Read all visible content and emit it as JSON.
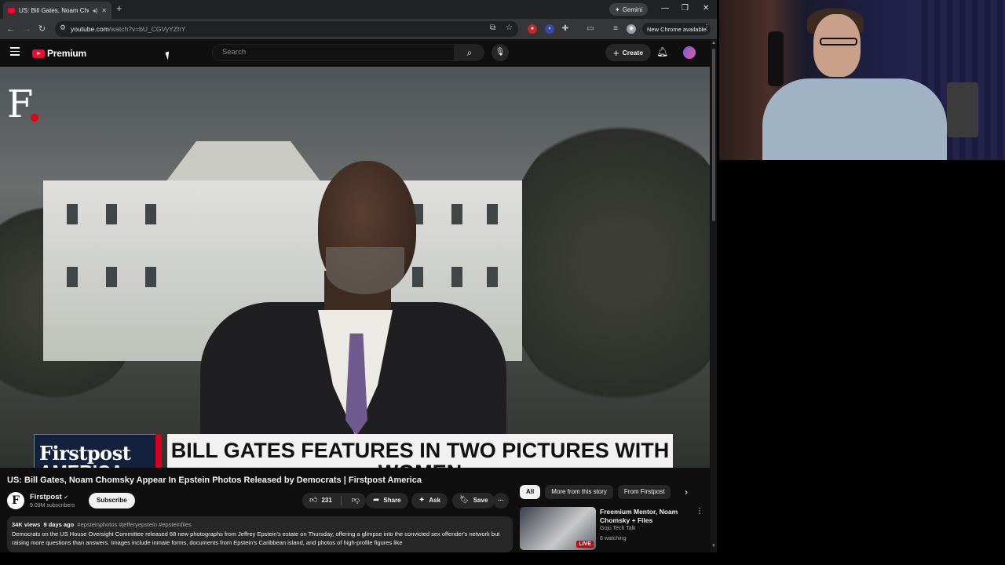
{
  "browser": {
    "tab_title": "US: Bill Gates, Noam Chomsk",
    "new_tab_symbol": "+",
    "gemini_label": "Gemini",
    "url_host": "youtube.com",
    "url_path": "/watch?v=bU_CGVyYZhY",
    "new_chrome_label": "New Chrome available"
  },
  "youtube": {
    "logo_text": "Premium",
    "search_placeholder": "Search",
    "create_label": "Create"
  },
  "video": {
    "overlay_logo": "F",
    "lower_third_brand_line1": "Firstpost",
    "lower_third_brand_line2": "AMERICA",
    "lower_third_headline": "BILL GATES FEATURES IN TWO PICTURES WITH WOMEN",
    "title": "US: Bill Gates, Noam Chomsky Appear In Epstein Photos Released by Democrats | Firstpost America"
  },
  "channel": {
    "avatar_letter": "F",
    "name": "Firstpost",
    "subscribers": "9.09M subscribers",
    "subscribe_label": "Subscribe"
  },
  "actions": {
    "likes": "231",
    "share_label": "Share",
    "ask_label": "Ask",
    "save_label": "Save",
    "more_symbol": "···"
  },
  "description": {
    "views": "34K views",
    "age": "9 days ago",
    "tags": "#epsteinphotos #jefferyepstein #epsteinfiles",
    "text": "Democrats on the US House Oversight Committee released 68 new photographs from Jeffrey Epstein's estate on Thursday, offering a glimpse into the convicted sex offender's network but raising more questions than answers. Images include inmate forms, documents from Epstein's Caribbean island, and photos of high-profile figures like"
  },
  "chips": [
    "All",
    "More from this story",
    "From Firstpost"
  ],
  "recommendation": {
    "title": "Freemium Mentor, Noam Chomsky + Files",
    "channel": "Goju Tech Talk",
    "watching": "8 watching",
    "live_badge": "LIVE"
  },
  "icons": {
    "menu": "hamburger-icon",
    "search": "magnifier-icon",
    "mic": "microphone-icon",
    "bell": "bell-icon",
    "like": "thumbs-up-icon",
    "dislike": "thumbs-down-icon",
    "share": "share-arrow-icon",
    "ask": "sparkle-icon",
    "save": "bookmark-icon"
  },
  "colors": {
    "yt_red": "#ff0033",
    "page_bg": "#0f0f0f",
    "lower_third_red": "#d4001d",
    "lower_third_navy": "#14213d"
  }
}
